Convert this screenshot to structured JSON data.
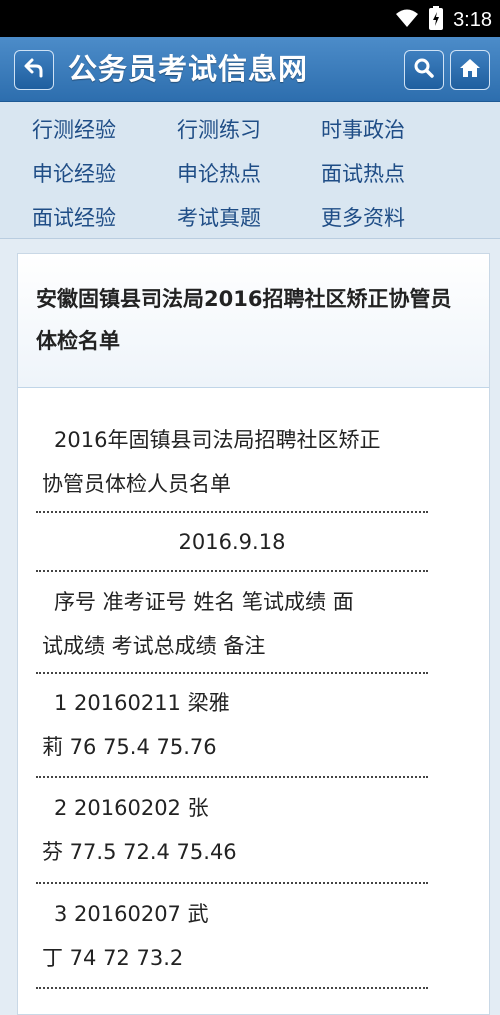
{
  "status_bar": {
    "time": "3:18",
    "wifi_icon": "wifi-icon",
    "battery_icon": "battery-icon"
  },
  "header": {
    "title": "公务员考试信息网",
    "back_icon": "back-arrow-icon",
    "search_icon": "search-icon",
    "home_icon": "home-icon"
  },
  "nav": {
    "links": [
      "行测经验",
      "行测练习",
      "时事政治",
      "申论经验",
      "申论热点",
      "面试热点",
      "面试经验",
      "考试真题",
      "更多资料"
    ]
  },
  "article": {
    "title_line1": "安徽固镇县司法局2016招聘社区矫正协管员",
    "title_line2": "体检名单",
    "intro_line1": "2016年固镇县司法局招聘社区矫正",
    "intro_line2": "协管员体检人员名单",
    "date": "2016.9.18",
    "header_line1": "序号 准考证号 姓名 笔试成绩 面",
    "header_line2": "试成绩 考试总成绩 备注",
    "rows": [
      {
        "line1": "1 20160211 梁雅",
        "line2": "莉 76 75.4 75.76"
      },
      {
        "line1": "2 20160202 张",
        "line2": "芬 77.5 72.4 75.46"
      },
      {
        "line1": "3 20160207 武",
        "line2": "丁 74 72 73.2"
      }
    ]
  },
  "colors": {
    "header_blue": "#2d6eae",
    "nav_bg": "#d9e6f1",
    "nav_text": "#1f4d86"
  }
}
